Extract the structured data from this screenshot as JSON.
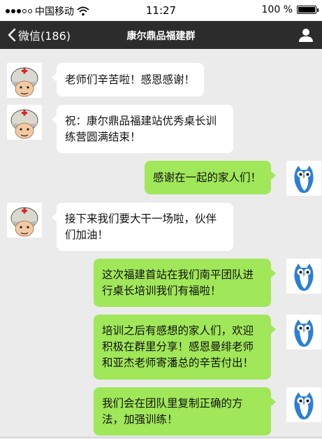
{
  "status_bar": {
    "carrier": "中国移动",
    "time": "11:27",
    "battery": "100 %",
    "battery_level": 1.0
  },
  "nav": {
    "back_label": "微信(186)",
    "title": "康尔鼎品福建群"
  },
  "messages": [
    {
      "side": "in",
      "avatar": "soldier-avatar-icon",
      "text": "老师们辛苦啦！感恩感谢！"
    },
    {
      "side": "in",
      "avatar": "soldier-avatar-icon",
      "lines": [
        "祝：康尔鼎品福建站优秀桌长训",
        "练营圆满结束！"
      ]
    },
    {
      "side": "out",
      "avatar": "owl-avatar-icon",
      "text": "感谢在一起的家人们！"
    },
    {
      "side": "in",
      "avatar": "soldier-avatar-icon",
      "lines": [
        "接下来我们要大干一场啦，伙伴",
        "们加油！"
      ]
    },
    {
      "side": "out",
      "avatar": "owl-avatar-icon",
      "lines": [
        "这次福建首站在我们南平团队进",
        "行桌长培训我们有福啦！"
      ]
    },
    {
      "side": "out",
      "avatar": "owl-avatar-icon",
      "lines": [
        "培训之后有感想的家人们，欢迎",
        "积极在群里分享！感恩曼绯老师",
        "和亚杰老师寄潘总的辛苦付出！"
      ]
    },
    {
      "side": "out",
      "avatar": "owl-avatar-icon",
      "lines": [
        "我们会在团队里复制正确的方",
        "法，加强训练！"
      ]
    }
  ],
  "colors": {
    "nav_background": "#2c2c2c",
    "chat_background": "#ebebeb",
    "outgoing_bubble": "#a0e759",
    "incoming_bubble": "#ffffff"
  }
}
